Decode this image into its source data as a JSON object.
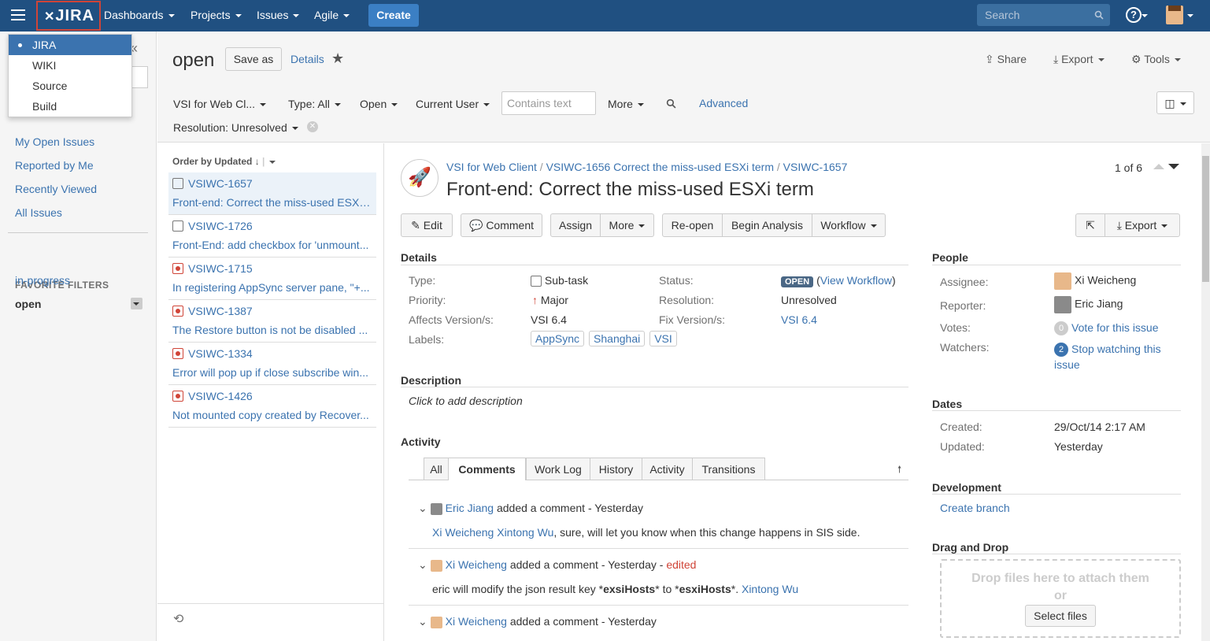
{
  "topbar": {
    "logo": "JIRA",
    "nav": [
      "Dashboards",
      "Projects",
      "Issues",
      "Agile"
    ],
    "create": "Create",
    "search_placeholder": "Search",
    "help": "?"
  },
  "app_menu": {
    "items": [
      "JIRA",
      "WIKI",
      "Source",
      "Build"
    ]
  },
  "sidebar": {
    "collapse": "«",
    "links": [
      "My Open Issues",
      "Reported by Me",
      "Recently Viewed",
      "All Issues"
    ],
    "fav_head": "FAVORITE FILTERS",
    "favs": [
      "in-progress",
      "open"
    ]
  },
  "header": {
    "title": "open",
    "save_as": "Save as",
    "details": "Details",
    "share": "Share",
    "export": "Export",
    "tools": "Tools"
  },
  "filters": {
    "project": "VSI for Web Cl...",
    "type": "Type: All",
    "status": "Open",
    "assignee": "Current User",
    "text_placeholder": "Contains text",
    "more": "More",
    "advanced": "Advanced",
    "resolution": "Resolution: Unresolved"
  },
  "list": {
    "order": "Order by Updated",
    "items": [
      {
        "key": "VSIWC-1657",
        "summary": "Front-end: Correct the miss-used ESXi term",
        "icon": "subtask"
      },
      {
        "key": "VSIWC-1726",
        "summary": "Front-End: add checkbox for 'unmount...",
        "icon": "subtask"
      },
      {
        "key": "VSIWC-1715",
        "summary": "In registering AppSync server pane, \"+...",
        "icon": "bug"
      },
      {
        "key": "VSIWC-1387",
        "summary": "The Restore button is not be disabled ...",
        "icon": "bug"
      },
      {
        "key": "VSIWC-1334",
        "summary": "Error will pop up if close subscribe win...",
        "icon": "bug"
      },
      {
        "key": "VSIWC-1426",
        "summary": "Not mounted copy created by Recover...",
        "icon": "bug"
      }
    ]
  },
  "issue": {
    "crumb_project": "VSI for Web Client",
    "crumb_parent": "VSIWC-1656 Correct the miss-used ESXi term",
    "crumb_key": "VSIWC-1657",
    "title": "Front-end: Correct the miss-used ESXi term",
    "pager": "1 of 6",
    "actions": {
      "edit": "Edit",
      "comment": "Comment",
      "assign": "Assign",
      "more": "More",
      "reopen": "Re-open",
      "begin": "Begin Analysis",
      "workflow": "Workflow",
      "export": "Export"
    },
    "details_head": "Details",
    "type_l": "Type:",
    "type_v": "Sub-task",
    "priority_l": "Priority:",
    "priority_v": "Major",
    "affects_l": "Affects Version/s:",
    "affects_v": "VSI 6.4",
    "labels_l": "Labels:",
    "labels": [
      "AppSync",
      "Shanghai",
      "VSI"
    ],
    "status_l": "Status:",
    "status_v": "OPEN",
    "view_wf": "View Workflow",
    "resolution_l": "Resolution:",
    "resolution_v": "Unresolved",
    "fix_l": "Fix Version/s:",
    "fix_v": "VSI 6.4",
    "desc_head": "Description",
    "desc": "Click to add description",
    "activity_head": "Activity",
    "tabs": [
      "All",
      "Comments",
      "Work Log",
      "History",
      "Activity",
      "Transitions"
    ],
    "comments": [
      {
        "author": "Eric Jiang",
        "action": "added a comment - Yesterday",
        "edited": "",
        "body_links": "Xi Weicheng Xintong Wu",
        "body": ", sure, will let you know when this change happens in SIS side."
      },
      {
        "author": "Xi Weicheng",
        "action": "added a comment - Yesterday - ",
        "edited": "edited",
        "body_pre": "eric will modify the json result key *",
        "k1": "exsiHosts",
        "mid": "* to *",
        "k2": "esxiHosts",
        "post": "*. ",
        "link": "Xintong Wu"
      },
      {
        "author": "Xi Weicheng",
        "action": "added a comment - Yesterday"
      }
    ]
  },
  "people": {
    "head": "People",
    "assignee_l": "Assignee:",
    "assignee": "Xi Weicheng",
    "reporter_l": "Reporter:",
    "reporter": "Eric Jiang",
    "votes_l": "Votes:",
    "votes_n": "0",
    "votes_link": "Vote for this issue",
    "watchers_l": "Watchers:",
    "watchers_n": "2",
    "watch_link": "Stop watching this issue"
  },
  "dates": {
    "head": "Dates",
    "created_l": "Created:",
    "created": "29/Oct/14 2:17 AM",
    "updated_l": "Updated:",
    "updated": "Yesterday"
  },
  "dev": {
    "head": "Development",
    "link": "Create branch"
  },
  "dnd": {
    "head": "Drag and Drop",
    "text": "Drop files here to attach them or",
    "button": "Select files"
  }
}
